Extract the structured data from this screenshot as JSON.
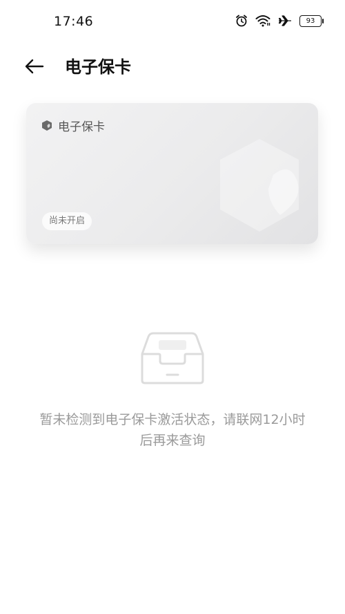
{
  "status_bar": {
    "time": "17:46",
    "battery": "93",
    "icons": [
      "alarm-icon",
      "wifi-icon",
      "airplane-icon",
      "battery-icon"
    ]
  },
  "header": {
    "back_icon": "arrow-left-icon",
    "title": "电子保卡"
  },
  "card": {
    "title": "电子保卡",
    "status": "尚未开启",
    "icon": "shield-icon"
  },
  "empty_state": {
    "icon": "inbox-tray-icon",
    "line1": "暂未检测到电子保卡激活状态，请联网12小时",
    "line2": "后再来查询"
  },
  "colors": {
    "text_primary": "#111111",
    "text_secondary": "#9a9a9a",
    "card_bg": "#ececed"
  }
}
